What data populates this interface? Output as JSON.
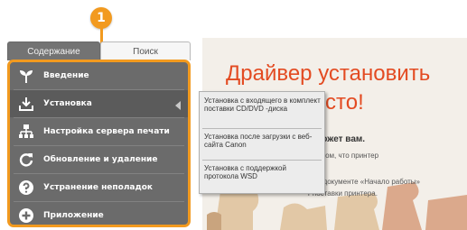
{
  "step_marker": "1",
  "tabs": [
    {
      "label": "Содержание"
    },
    {
      "label": "Поиск"
    }
  ],
  "menu": {
    "items": [
      {
        "label": "Введение",
        "icon": "sprout-icon"
      },
      {
        "label": "Установка",
        "icon": "download-icon"
      },
      {
        "label": "Настройка сервера печати",
        "icon": "network-icon"
      },
      {
        "label": "Обновление и удаление",
        "icon": "refresh-icon"
      },
      {
        "label": "Устранение неполадок",
        "icon": "question-icon"
      },
      {
        "label": "Приложение",
        "icon": "plus-icon"
      }
    ],
    "active_index": 1
  },
  "submenu": {
    "items": [
      {
        "label": "Установка с входящего в комплект поставки CD/DVD -диска"
      },
      {
        "label": "Установка после загрузки с веб-сайта Canon"
      },
      {
        "label": "Установка с поддержкой протокола WSD"
      }
    ]
  },
  "content": {
    "title_line1": "Драйвер установить",
    "title_line2": "сто!",
    "subheading": "может вам.",
    "line1": "ть в том, что принтер",
    "line2": "на в документе «Начало работы»",
    "line3": "т поставки принтера."
  },
  "colors": {
    "accent": "#f29a1f",
    "menu_bg": "#6b6b6b",
    "title_red": "#e34b22"
  }
}
